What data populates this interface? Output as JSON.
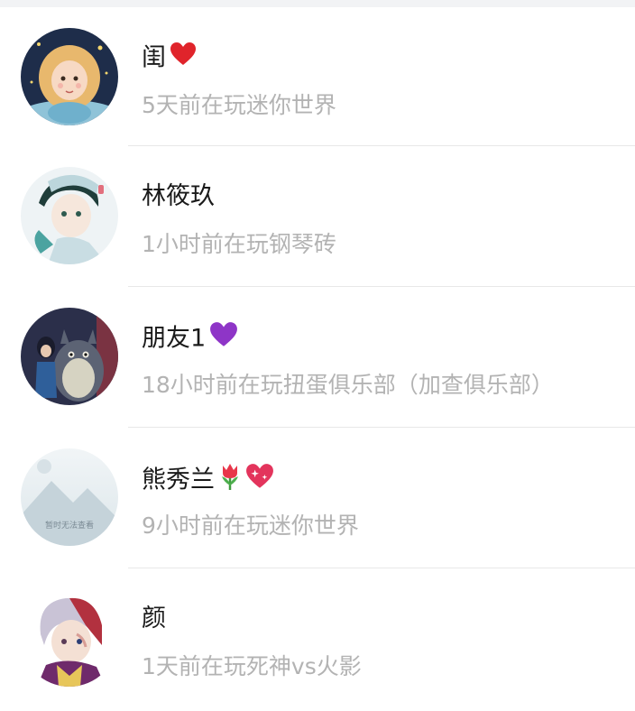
{
  "friends": [
    {
      "name": "闺",
      "decorations": [
        "red-heart"
      ],
      "status": "5天前在玩迷你世界"
    },
    {
      "name": "林筱玖",
      "decorations": [],
      "status": "1小时前在玩钢琴砖"
    },
    {
      "name": "朋友1",
      "decorations": [
        "purple-heart"
      ],
      "status": "18小时前在玩扭蛋俱乐部（加查俱乐部）"
    },
    {
      "name": "熊秀兰",
      "decorations": [
        "tulip",
        "sparkling-heart"
      ],
      "status": "9小时前在玩迷你世界",
      "avatar_placeholder_text": "暂时无法查看"
    },
    {
      "name": "颜",
      "decorations": [],
      "status": "1天前在玩死神vs火影"
    }
  ],
  "colors": {
    "name_text": "#1a1a1a",
    "status_text": "#b3b3b3",
    "divider": "#e8e8e8",
    "top_bar": "#f2f3f5"
  }
}
